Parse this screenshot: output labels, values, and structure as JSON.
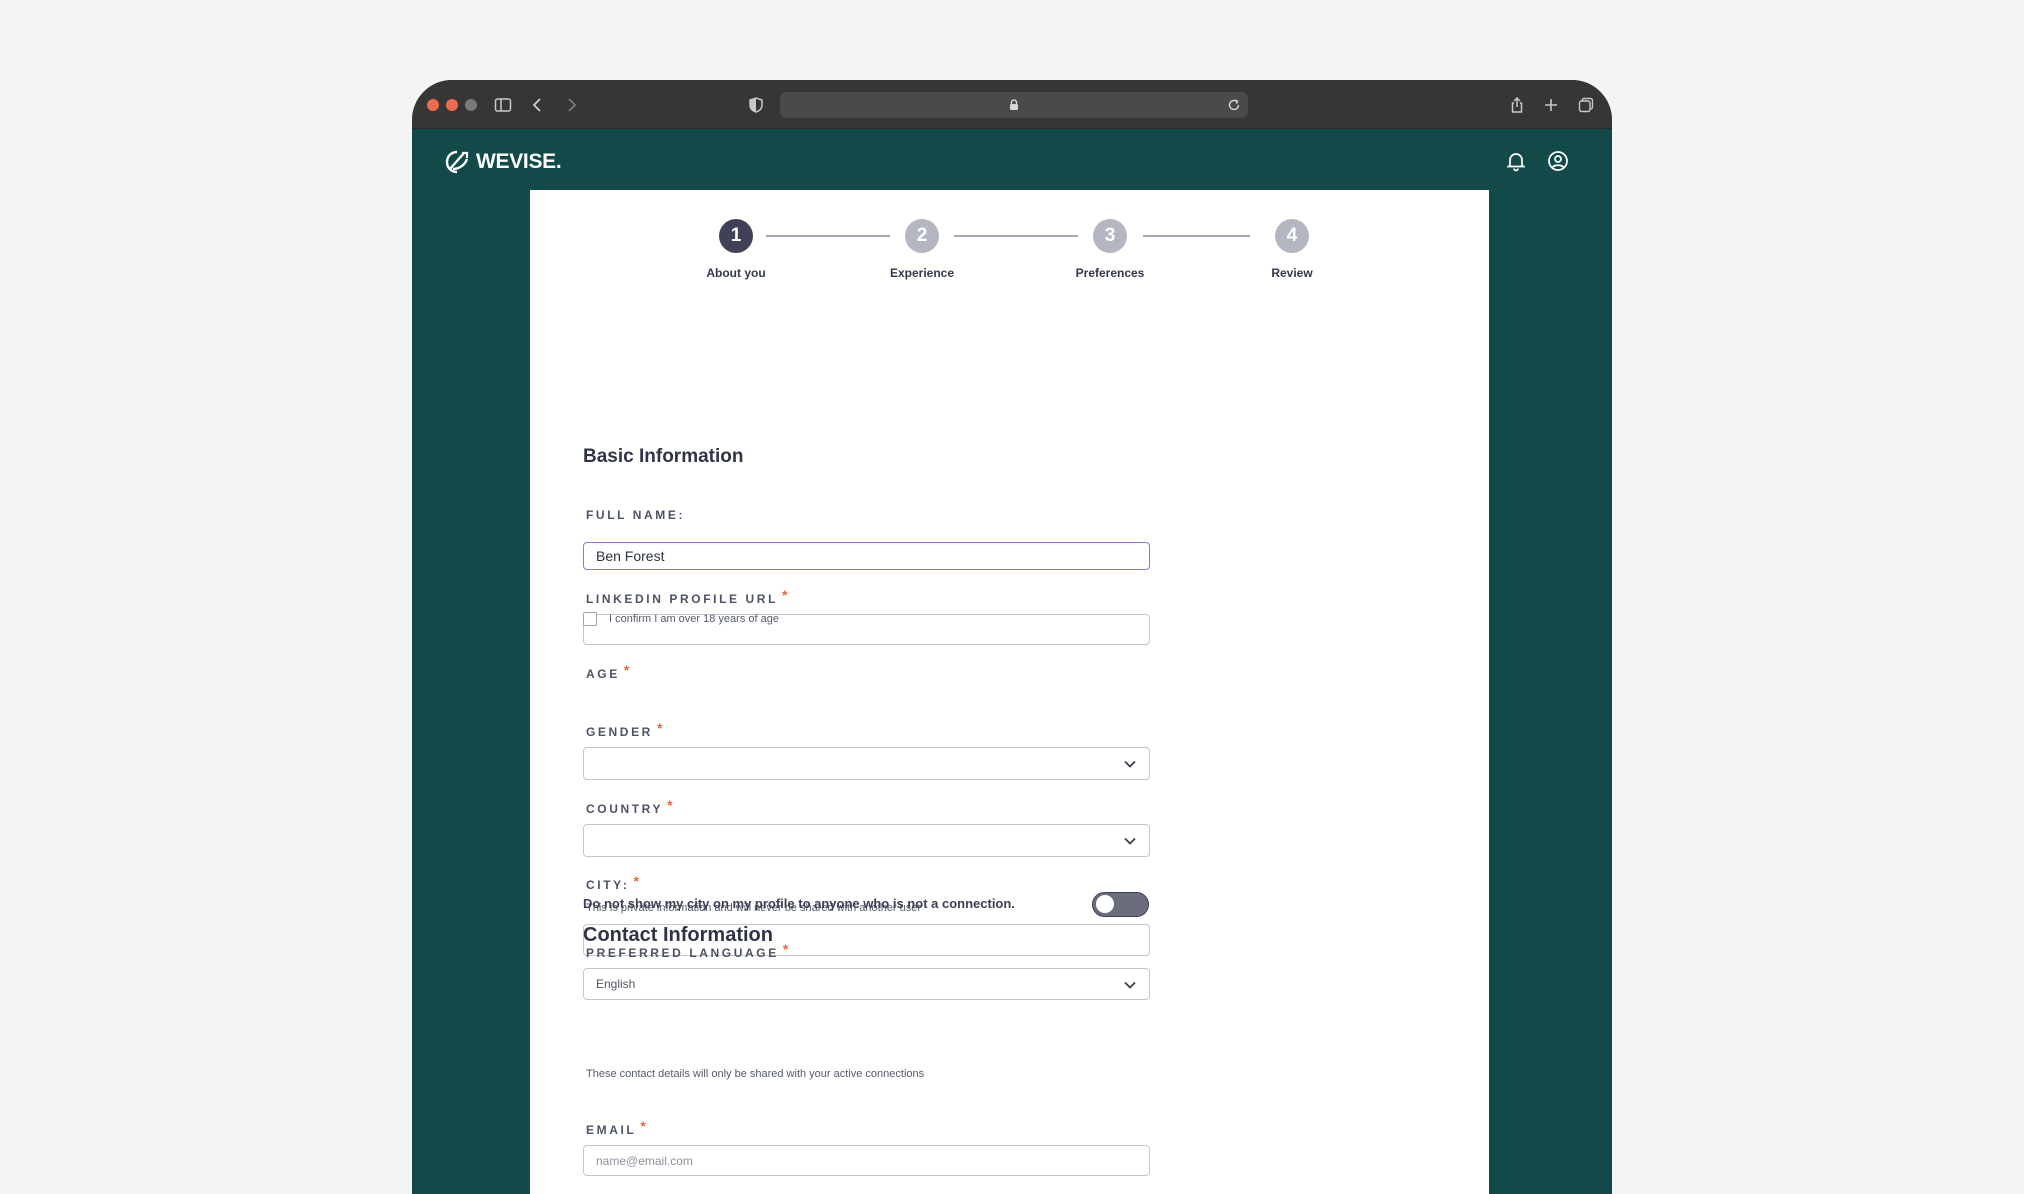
{
  "brand": {
    "name": "WEVISE.",
    "color": "#124a4a"
  },
  "browser": {
    "url": ""
  },
  "stepper": {
    "steps": [
      {
        "number": "1",
        "label": "About you",
        "active": true
      },
      {
        "number": "2",
        "label": "Experience",
        "active": false
      },
      {
        "number": "3",
        "label": "Preferences",
        "active": false
      },
      {
        "number": "4",
        "label": "Review",
        "active": false
      }
    ]
  },
  "basic": {
    "title": "Basic Information",
    "full_name": {
      "label": "FULL NAME:",
      "value": "Ben Forest"
    },
    "linkedin": {
      "label": "LINKEDIN PROFILE URL",
      "required": "*",
      "value": ""
    },
    "age": {
      "label": "AGE",
      "required": "*",
      "checkbox_label": "I confirm I am over 18 years of age",
      "checked": false
    },
    "gender": {
      "label": "GENDER",
      "required": "*",
      "value": ""
    },
    "country": {
      "label": "COUNTRY",
      "required": "*",
      "value": ""
    },
    "city": {
      "label": "CITY:",
      "required": "*",
      "helper": "This is private information and will never be shared with another user",
      "value": ""
    },
    "city_toggle": {
      "label": "Do not show my city on my profile to anyone who is not a connection.",
      "on": false
    },
    "language": {
      "label": "PREFERRED LANGUAGE",
      "required": "*",
      "value": "English"
    }
  },
  "contact": {
    "title": "Contact Information",
    "subtitle": "These contact details will only be shared with your active connections",
    "email": {
      "label": "EMAIL",
      "required": "*",
      "placeholder": "name@email.com"
    }
  },
  "icons": {
    "browser": [
      "sidebar-icon",
      "back-icon",
      "forward-icon",
      "shield-icon",
      "lock-icon",
      "reload-icon",
      "share-icon",
      "plus-icon",
      "tabs-icon"
    ],
    "nav": [
      "bell-icon",
      "user-icon"
    ]
  }
}
